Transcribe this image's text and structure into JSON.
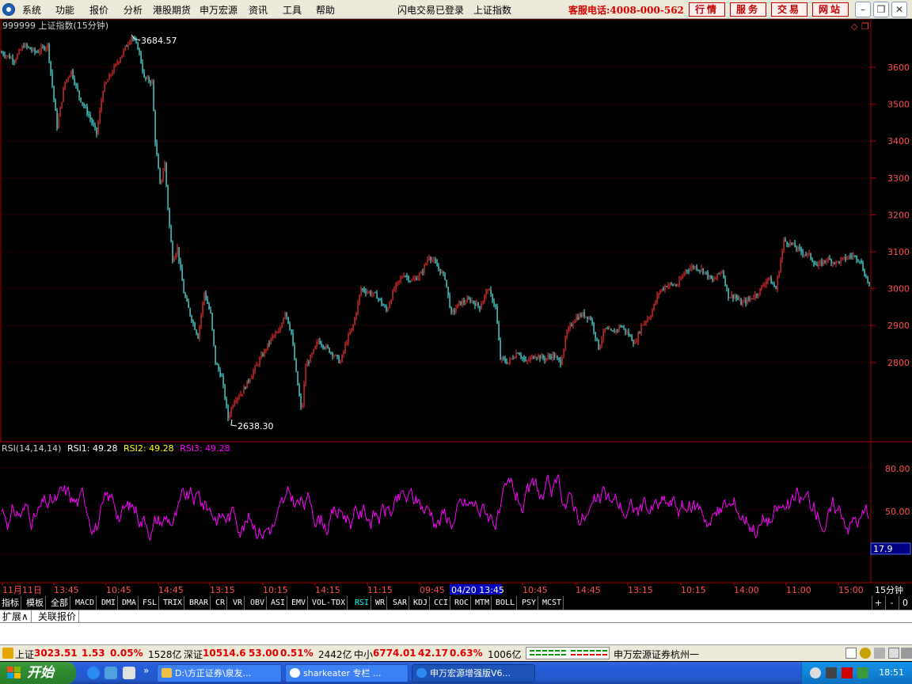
{
  "menu": {
    "items": [
      "系统",
      "功能",
      "报价",
      "分析",
      "港股期货",
      "申万宏源",
      "资讯",
      "工具",
      "帮助"
    ],
    "status": "闪电交易已登录",
    "title": "上证指数",
    "hotline": "客服电话:4008-000-562",
    "quick_buttons": [
      "行情",
      "服务",
      "交易",
      "网站"
    ]
  },
  "chart": {
    "header": "999999 上证指数(15分钟)",
    "high_label": "3684.57",
    "low_label": "2638.30",
    "price_ticks": [
      "3600",
      "3500",
      "3400",
      "3300",
      "3200",
      "3100",
      "3000",
      "2900",
      "2800"
    ],
    "price_tick_values": [
      3600,
      3500,
      3400,
      3300,
      3200,
      3100,
      3000,
      2900,
      2800
    ]
  },
  "indicator": {
    "name": "RSI(14,14,14)",
    "rsi1": "RSI1: 49.28",
    "rsi2": "RSI2: 49.28",
    "rsi3": "RSI3: 49.28",
    "ticks": [
      "80.00",
      "50.00"
    ],
    "current": "17.9"
  },
  "time_axis": {
    "labels": [
      "11月11日",
      "13:45",
      "10:45",
      "14:45",
      "13:15",
      "10:15",
      "14:15",
      "11:15",
      "09:45",
      "04/20 13:45",
      "10:45",
      "14:45",
      "13:15",
      "10:15",
      "14:00",
      "11:00",
      "15:00"
    ],
    "period": "15分钟"
  },
  "indicator_tabs": [
    "指标",
    "模板",
    "全部",
    "MACD",
    "DMI",
    "DMA",
    "FSL",
    "TRIX",
    "BRAR",
    "CR",
    "VR",
    "OBV",
    "ASI",
    "EMV",
    "VOL-TDX",
    "RSI",
    "WR",
    "SAR",
    "KDJ",
    "CCI",
    "ROC",
    "MTM",
    "BOLL",
    "PSY",
    "MCST"
  ],
  "indicator_controls": [
    "+",
    "-",
    "0"
  ],
  "ext_tabs": [
    "扩展∧",
    "关联报价"
  ],
  "status_bar": {
    "sh_label": "上证",
    "sh_value": "3023.51",
    "sh_change": "1.53",
    "sh_pct": "0.05%",
    "sh_amount": "1528亿",
    "sz_label": "深证",
    "sz_value": "10514.6",
    "sz_change": "53.00",
    "sz_pct": "0.51%",
    "sz_amount": "2442亿",
    "zx_label": "中小",
    "zx_value": "6774.01",
    "zx_change": "42.17",
    "zx_pct": "0.63%",
    "zx_amount": "1006亿",
    "broker": "申万宏源证券杭州一"
  },
  "taskbar": {
    "start": "开始",
    "tasks": [
      "D:\\方正证券\\泉友...",
      "sharkeater 专栏 ...",
      "申万宏源增强版V6..."
    ],
    "clock": "18:51"
  },
  "colors": {
    "up": "#ff3232",
    "down": "#54ffff",
    "rsi_line": "#ff00ff",
    "frame": "#b00000",
    "axis_text": "#ff5050"
  }
}
